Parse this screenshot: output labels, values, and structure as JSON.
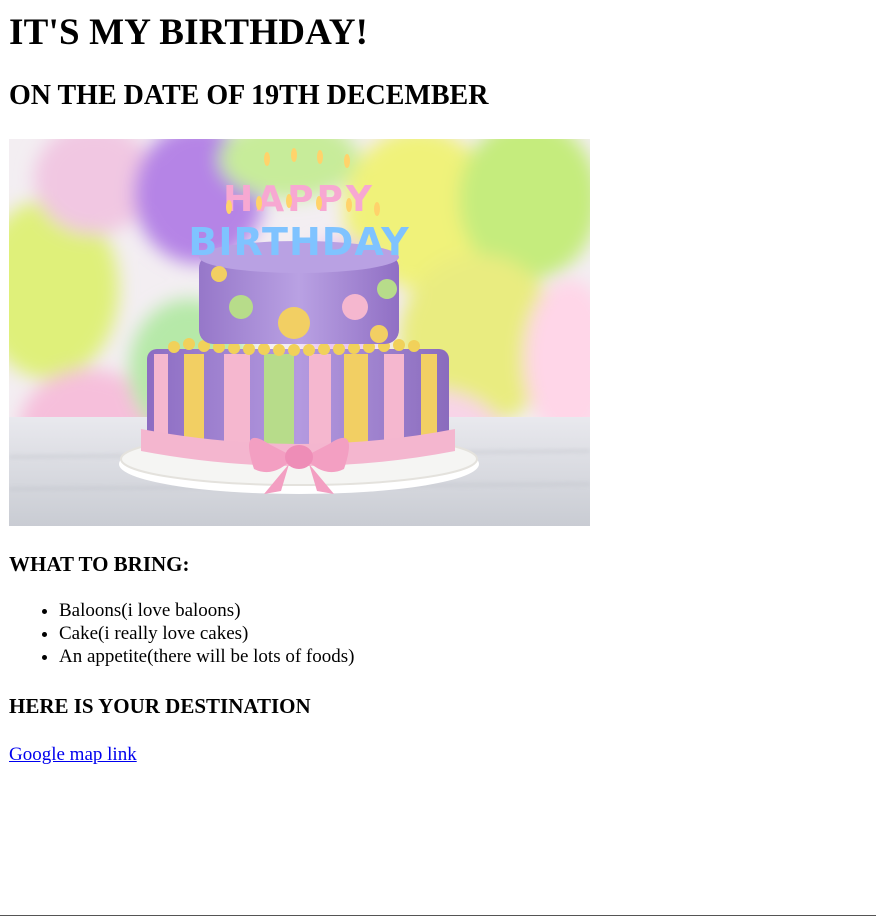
{
  "page": {
    "title": "IT'S MY BIRTHDAY!",
    "subtitle": "ON THE DATE OF 19TH DECEMBER"
  },
  "image": {
    "alt": "HAPPY BIRTHDAY",
    "candle_top": "HAPPY",
    "candle_bottom": "BIRTHDAY"
  },
  "bring": {
    "heading": "WHAT TO BRING:",
    "items": [
      "Baloons(i love baloons)",
      "Cake(i really love cakes)",
      "An appetite(there will be lots of foods)"
    ]
  },
  "destination": {
    "heading": "HERE IS YOUR DESTINATION",
    "link_text": "Google map link"
  },
  "colors": {
    "link": "#0000ee",
    "cake_purple": "#a98ad6",
    "ribbon_pink": "#f5b7cf",
    "stripe_yellow": "#f2cf63",
    "stripe_green": "#b7dc8a"
  }
}
